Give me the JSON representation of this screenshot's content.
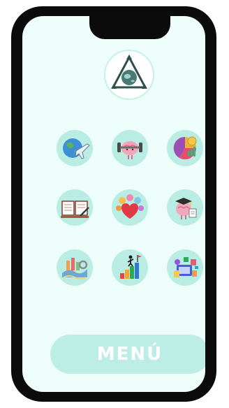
{
  "menu": {
    "button_label": "MENÚ"
  },
  "colors": {
    "screen_bg": "#edfdf9",
    "circle_bg": "#b9ece3",
    "button_bg": "#bdeee5",
    "frame": "#0b0b0b"
  },
  "logo": {
    "icon": "recycle-globe-icon"
  },
  "grid": [
    {
      "icon": "globe-airplane-icon"
    },
    {
      "icon": "brain-dumbbell-icon"
    },
    {
      "icon": "finance-chart-icon"
    },
    {
      "icon": "open-book-icon"
    },
    {
      "icon": "social-heart-icon"
    },
    {
      "icon": "graduate-brain-icon"
    },
    {
      "icon": "gears-landscape-icon"
    },
    {
      "icon": "growth-stairs-icon"
    },
    {
      "icon": "shopping-collage-icon"
    }
  ]
}
